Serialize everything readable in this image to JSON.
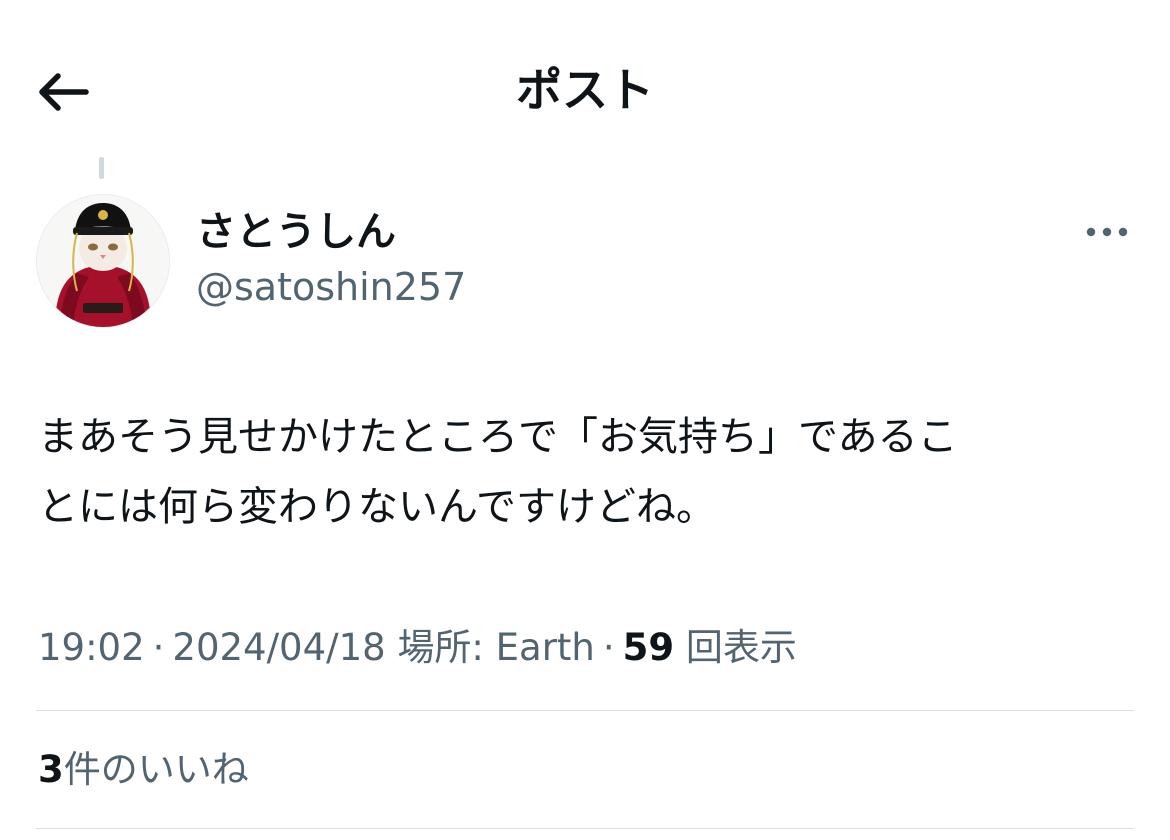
{
  "header": {
    "title": "ポスト",
    "back_icon": "arrow-left-icon"
  },
  "post": {
    "author": {
      "display_name": "さとうしん",
      "handle": "@satoshin257",
      "avatar_icon": "cat-in-red-costume-avatar"
    },
    "more_icon": "more-horizontal-icon",
    "text_line1": "まあそう見せかけたところで「お気持ち」であるこ",
    "text_line2": "とには何ら変わりないんですけどね。",
    "time": "19:02",
    "separator": "·",
    "date": "2024/04/18",
    "location": "場所: Earth",
    "views_count": "59",
    "views_label": "回表示",
    "likes_count": "3",
    "likes_label": "件のいいね"
  },
  "colors": {
    "text_primary": "#0f1419",
    "text_secondary": "#536471",
    "divider": "#d9dfe3",
    "thread_line": "#cfd9de"
  }
}
